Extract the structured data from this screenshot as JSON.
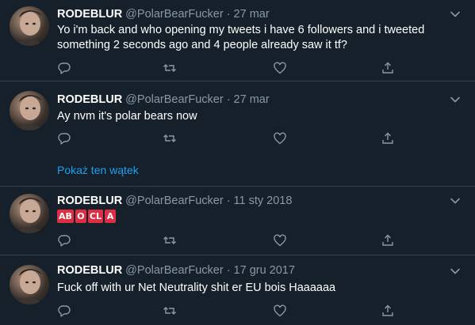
{
  "tweets": [
    {
      "name": "RODEBLUR",
      "handle": "@PolarBearFucker",
      "separator": "·",
      "date": "27 mar",
      "text_line1": "Yo i'm back and who opening my tweets i have 6 followers and i tweeted",
      "text_line2": "something 2 seconds ago and 4 people already saw it tf?"
    },
    {
      "name": "RODEBLUR",
      "handle": "@PolarBearFucker",
      "separator": "·",
      "date": "27 mar",
      "text": "Ay nvm it's polar bears now",
      "show_thread": "Pokaż ten wątek"
    },
    {
      "name": "RODEBLUR",
      "handle": "@PolarBearFucker",
      "separator": "·",
      "date": "11 sty 2018",
      "emoji_badges": [
        "AB",
        "O",
        "CL",
        "A"
      ]
    },
    {
      "name": "RODEBLUR",
      "handle": "@PolarBearFucker",
      "separator": "·",
      "date": "17 gru 2017",
      "text": "Fuck off with ur Net Neutrality shit er EU bois Haaaaaa"
    }
  ],
  "icons": {
    "reply": "reply-icon",
    "retweet": "retweet-icon",
    "like": "like-icon",
    "share": "share-icon",
    "more": "chevron-down-icon"
  },
  "colors": {
    "background": "#15202b",
    "secondary_text": "#8899a6",
    "link": "#1da1f2",
    "divider": "#38444d",
    "emoji_red": "#dd2e44"
  }
}
